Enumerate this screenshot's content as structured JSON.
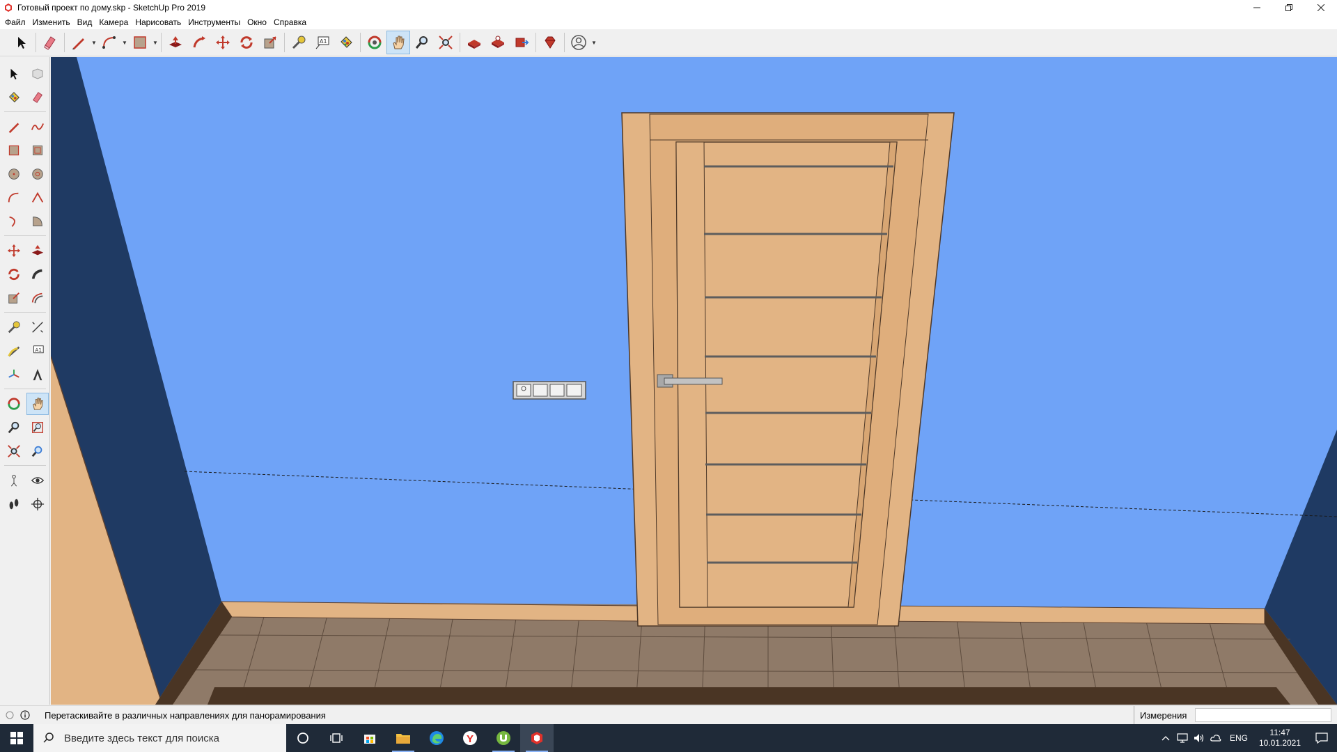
{
  "window": {
    "title": "Готовый проект по дому.skp - SketchUp Pro 2019",
    "controls": [
      "minimize-icon",
      "restore-icon",
      "close-icon"
    ]
  },
  "menu": [
    "Файл",
    "Изменить",
    "Вид",
    "Камера",
    "Нарисовать",
    "Инструменты",
    "Окно",
    "Справка"
  ],
  "toolbar": {
    "tools": [
      "select",
      "eraser",
      "line",
      "arc",
      "rectangle",
      "push-pull",
      "follow-me",
      "move",
      "rotate",
      "scale",
      "tape-measure",
      "text",
      "paint-bucket",
      "orbit",
      "pan",
      "zoom",
      "zoom-extents",
      "warehouse",
      "extension-warehouse",
      "layout",
      "ruby",
      "account"
    ],
    "active": "pan"
  },
  "palette": {
    "active": "pan",
    "rows": [
      [
        "select",
        "component"
      ],
      [
        "paint-bucket",
        "eraser"
      ],
      [
        "line",
        "freehand"
      ],
      [
        "rectangle",
        "rotated-rectangle"
      ],
      [
        "circle",
        "polygon"
      ],
      [
        "arc",
        "two-point-arc"
      ],
      [
        "three-point-arc",
        "pie"
      ],
      [
        "move",
        "push-pull"
      ],
      [
        "rotate",
        "follow-me"
      ],
      [
        "scale",
        "offset"
      ],
      [
        "tape-measure",
        "dimension"
      ],
      [
        "protractor",
        "text"
      ],
      [
        "axes",
        "3d-text"
      ],
      [
        "orbit",
        "pan"
      ],
      [
        "zoom",
        "zoom-window"
      ],
      [
        "zoom-extents",
        "previous"
      ],
      [
        "position-camera",
        "look-around"
      ],
      [
        "walk",
        "section-plane"
      ]
    ]
  },
  "status": {
    "hint": "Перетаскивайте в различных направлениях для панорамирования",
    "measure_label": "Измерения",
    "measure_value": ""
  },
  "taskbar": {
    "search_placeholder": "Введите здесь текст для поиска",
    "apps": [
      "cortana",
      "task-view",
      "store",
      "file-explorer",
      "edge",
      "yandex-browser",
      "utorrent",
      "sketchup"
    ],
    "lang": "ENG",
    "time": "11:47",
    "date": "10.01.2021"
  },
  "colors": {
    "wall": "#6fa3f7",
    "side_wall": "#1f3a63",
    "door": "#e2b484",
    "floor": "#8f7a68",
    "baseboard": "#e2b484"
  }
}
